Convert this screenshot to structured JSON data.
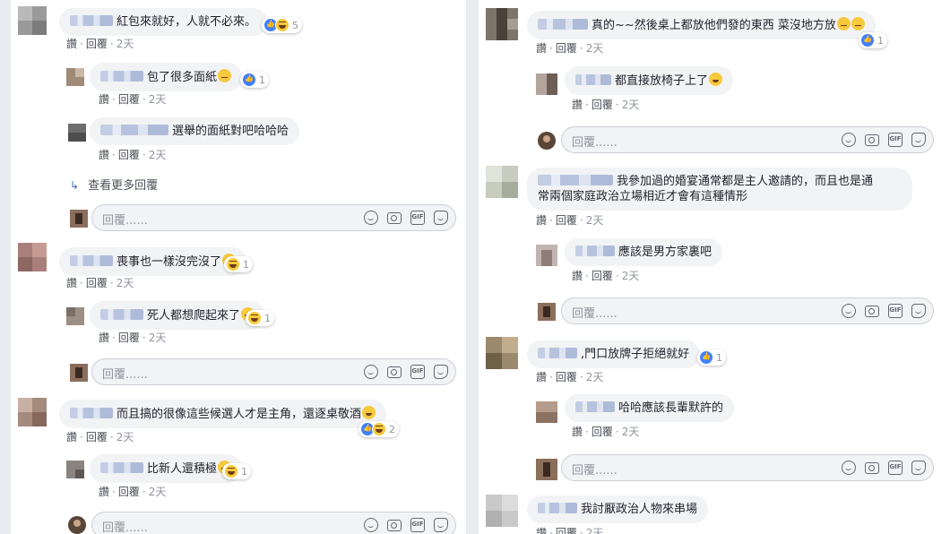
{
  "common": {
    "like": "讚",
    "reply": "回覆",
    "time": "2天",
    "placeholder": "回覆......",
    "gif": "GIF"
  },
  "left": {
    "c1": {
      "text": "紅包來就好，人就不必來。",
      "react_count": "5"
    },
    "r1": {
      "text": "包了很多面紙",
      "react_count": "1"
    },
    "r2": {
      "text": "選舉的面紙對吧哈哈哈"
    },
    "more_replies": "查看更多回覆",
    "c2": {
      "text": "喪事也一樣沒完沒了",
      "react_count": "1"
    },
    "r3": {
      "text": "死人都想爬起來了",
      "react_count": "1"
    },
    "c3": {
      "text": "而且搞的很像這些候選人才是主角，還逐桌敬酒",
      "react_count": "2"
    },
    "r4": {
      "text": "比新人還積極",
      "react_count": "1"
    }
  },
  "right": {
    "c1": {
      "text": "真的~~然後桌上都放他們發的東西 菜沒地方放",
      "react_count": "1"
    },
    "r1": {
      "text": "都直接放椅子上了"
    },
    "c2": {
      "text_line1": "我參加過的婚宴通常都是主人邀請的，而且也是通",
      "text_line2": "常兩個家庭政治立場相近才會有這種情形"
    },
    "r2": {
      "text": "應該是男方家裏吧"
    },
    "c3": {
      "text": ",門口放牌子拒絕就好",
      "react_count": "1"
    },
    "r3": {
      "text": "哈哈應該長輩默許的"
    },
    "c4": {
      "text": "我討厭政治人物來串場"
    }
  },
  "colors": {
    "bubble": "#f2f3f5",
    "link": "#4267b2",
    "like_blue": "#4080ff",
    "haha_yellow": "#f7c93b",
    "page_bg": "#e9ebee"
  }
}
